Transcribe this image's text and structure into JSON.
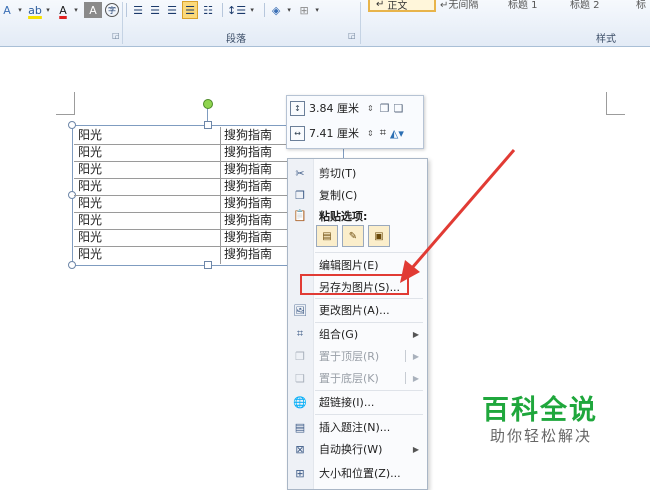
{
  "ribbon": {
    "font_group_icons": [
      "text-effects-icon",
      "highlight-icon",
      "font-color-icon",
      "char-shading-icon",
      "enclosed-char-icon"
    ],
    "para_group_icons": [
      "align-left-icon",
      "align-center-icon",
      "align-right-icon",
      "justify-icon",
      "distributed-icon",
      "line-spacing-icon",
      "shading-icon",
      "border-icon"
    ],
    "paragraph_label": "段落",
    "styles_label": "样式",
    "styles": [
      "正文",
      "无间隔",
      "标题 1",
      "标题 2",
      "标"
    ]
  },
  "table": {
    "rows": [
      {
        "c1": "阳光",
        "c2": "搜狗指南"
      },
      {
        "c1": "阳光",
        "c2": "搜狗指南"
      },
      {
        "c1": "阳光",
        "c2": "搜狗指南"
      },
      {
        "c1": "阳光",
        "c2": "搜狗指南"
      },
      {
        "c1": "阳光",
        "c2": "搜狗指南"
      },
      {
        "c1": "阳光",
        "c2": "搜狗指南"
      },
      {
        "c1": "阳光",
        "c2": "搜狗指南"
      },
      {
        "c1": "阳光",
        "c2": "搜狗指南"
      }
    ]
  },
  "mini_toolbar": {
    "height_value": "3.84 厘米",
    "width_value": "7.41 厘米"
  },
  "context_menu": {
    "cut": "剪切(T)",
    "copy": "复制(C)",
    "paste_options": "粘贴选项:",
    "edit_picture": "编辑图片(E)",
    "save_as_picture": "另存为图片(S)...",
    "change_picture": "更改图片(A)...",
    "group": "组合(G)",
    "bring_to_front": "置于顶层(R)",
    "send_to_back": "置于底层(K)",
    "hyperlink": "超链接(I)...",
    "insert_caption": "插入题注(N)...",
    "wrap_text": "自动换行(W)",
    "size_position": "大小和位置(Z)..."
  },
  "annotation": {
    "highlight_color": "#e13b34"
  },
  "watermark": {
    "title": "百科全说",
    "subtitle": "助你轻松解决",
    "color": "#1fa73c"
  }
}
